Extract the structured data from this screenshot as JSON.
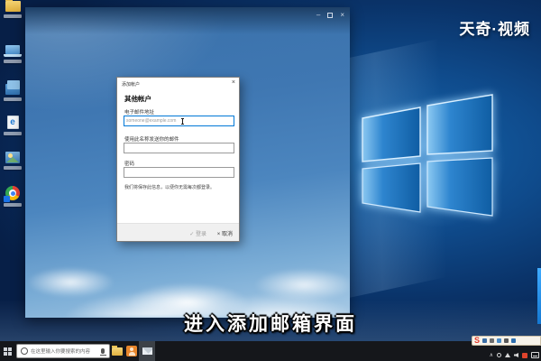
{
  "colors": {
    "accent_blue": "#0078d7",
    "wallpaper_navy": "#0a3369",
    "window_sky": "#4c86bf",
    "taskbar_bg": "#15171b",
    "sogou_red": "#e23c2e",
    "folder_yellow": "#e2b13f",
    "orange_app": "#e8862c"
  },
  "watermark": {
    "text": "天奇·视频"
  },
  "subtitle": {
    "text": "进入添加邮箱界面"
  },
  "desktop": {
    "icons": [
      {
        "name": "folder"
      },
      {
        "name": "pc"
      },
      {
        "name": "netdisk-folders"
      },
      {
        "name": "document-e",
        "glyph": "e"
      },
      {
        "name": "photos"
      },
      {
        "name": "chrome",
        "badge_glyph": "F"
      }
    ]
  },
  "mail_window": {
    "controls": {
      "minimize": "–",
      "close": "×"
    }
  },
  "dialog": {
    "title": "添加帐户",
    "close_glyph": "×",
    "heading": "其他帐户",
    "email_label": "电子邮件地址",
    "email_placeholder": "someone@example.com",
    "name_label": "使用此名称发送你的邮件",
    "password_label": "密码",
    "note": "我们将保存此信息，以便你无需每次都登录。",
    "signin_icon": "✓",
    "signin_label": "登录",
    "cancel_icon": "×",
    "cancel_label": "取消"
  },
  "taskbar": {
    "search_placeholder": "在这里输入你要搜索的内容",
    "sogou_letter": "S",
    "tray_chevron": "∧"
  }
}
